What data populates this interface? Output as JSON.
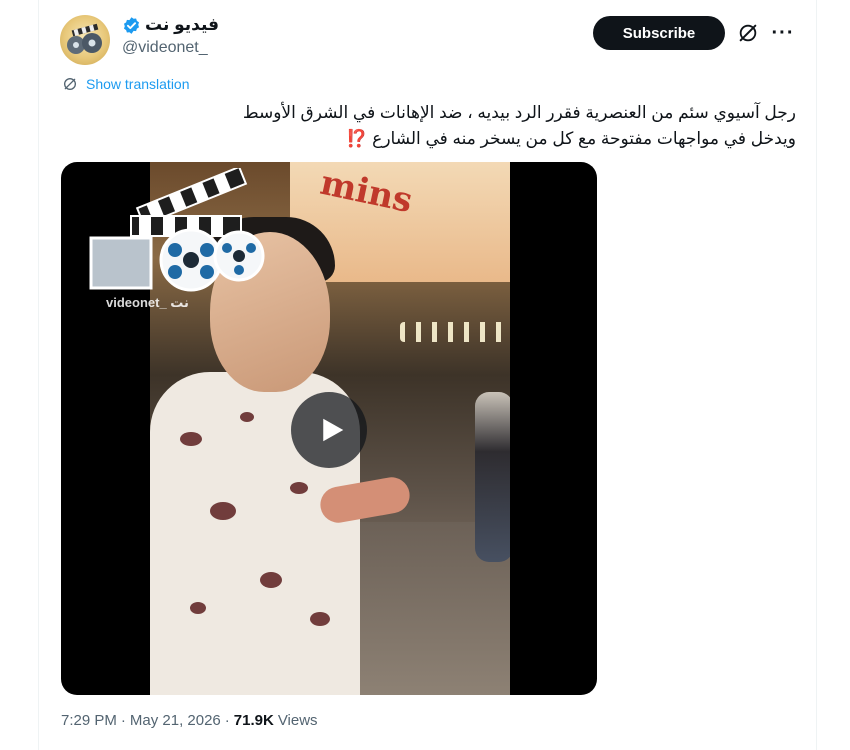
{
  "author": {
    "display_name": "فيديو نت",
    "handle": "@videonet_",
    "verified": true,
    "avatar_icon": "film-reel-avatar"
  },
  "actions": {
    "subscribe_label": "Subscribe",
    "grok_icon": "grok-icon",
    "more_icon": "more-dots-icon",
    "more_glyph": "···"
  },
  "translation": {
    "label": "Show translation",
    "icon": "globe-icon"
  },
  "tweet": {
    "line1": "رجل آسيوي سئم من العنصرية فقرر الرد بيديه ، ضد الإهانات في الشرق الأوسط",
    "line2": "ويدخل في مواجهات مفتوحة مع كل من يسخر منه في الشارع",
    "emoji": "⁉️"
  },
  "media": {
    "type": "video",
    "watermark": "videonet_ نت",
    "sign_text": "mins",
    "play_icon": "play-icon"
  },
  "meta": {
    "time": "7:29 PM",
    "separator": "·",
    "date": "May 21, 2026",
    "views_count": "71.9K",
    "views_label": "Views"
  },
  "colors": {
    "accent": "#1d9bf0",
    "text": "#0f1419",
    "secondary": "#536471",
    "button_bg": "#0f1419"
  }
}
